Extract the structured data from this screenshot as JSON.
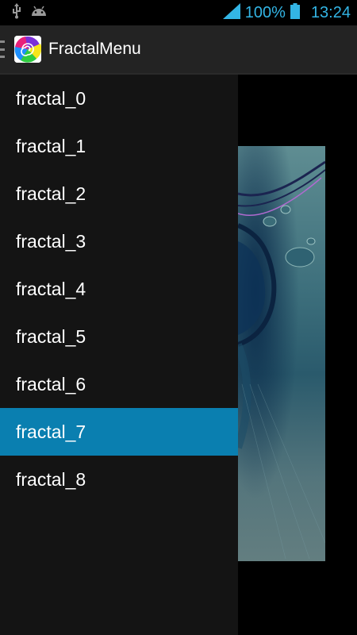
{
  "status_bar": {
    "icons_left": [
      "usb-icon",
      "android-debug-icon"
    ],
    "signal_icon": "signal-icon",
    "battery_percent": "100%",
    "battery_icon": "battery-icon",
    "time": "13:24",
    "accent_color": "#33b5e5"
  },
  "action_bar": {
    "title": "FractalMenu",
    "app_icon": "fractal-app-icon",
    "drawer_indicator_icon": "drawer-indicator-icon"
  },
  "drawer": {
    "selected_color": "#0a7fb0",
    "items": [
      {
        "label": "fractal_0",
        "selected": false
      },
      {
        "label": "fractal_1",
        "selected": false
      },
      {
        "label": "fractal_2",
        "selected": false
      },
      {
        "label": "fractal_3",
        "selected": false
      },
      {
        "label": "fractal_4",
        "selected": false
      },
      {
        "label": "fractal_5",
        "selected": false
      },
      {
        "label": "fractal_6",
        "selected": false
      },
      {
        "label": "fractal_7",
        "selected": true
      },
      {
        "label": "fractal_8",
        "selected": false
      }
    ]
  },
  "content": {
    "image": "fractal-image"
  }
}
